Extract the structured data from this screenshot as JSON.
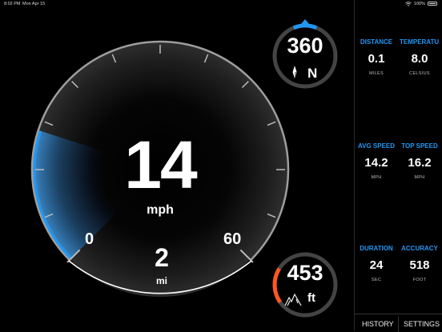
{
  "status_bar": {
    "time": "8:02 PM",
    "date": "Mon Apr 15",
    "battery": "100%",
    "wifi_icon": "wifi-icon",
    "battery_icon": "battery-icon"
  },
  "speedometer": {
    "speed": "14",
    "unit": "mph",
    "scale_min": "0",
    "scale_max": "60",
    "trip_distance": "2",
    "trip_unit": "mi",
    "progress": 0.233,
    "accent_color": "#2196f3"
  },
  "compass": {
    "heading": "360",
    "direction": "N",
    "icon": "compass-needle-icon",
    "accent_color": "#2196f3"
  },
  "altitude": {
    "value": "453",
    "unit": "ft",
    "icon": "mountain-icon",
    "accent_color": "#ff5722"
  },
  "stats": [
    {
      "label": "DISTANCE",
      "value": "0.1",
      "unit": "MILES"
    },
    {
      "label": "TEMPERATU...",
      "value": "8.0",
      "unit": "CELSIUS"
    },
    {
      "label": "AVG SPEED",
      "value": "14.2",
      "unit": "MPH"
    },
    {
      "label": "TOP SPEED",
      "value": "16.2",
      "unit": "MPH"
    },
    {
      "label": "DURATION",
      "value": "24",
      "unit": "SEC"
    },
    {
      "label": "ACCURACY",
      "value": "518",
      "unit": "FOOT"
    }
  ],
  "bottom_bar": {
    "history": "HISTORY",
    "settings": "SETTINGS"
  }
}
